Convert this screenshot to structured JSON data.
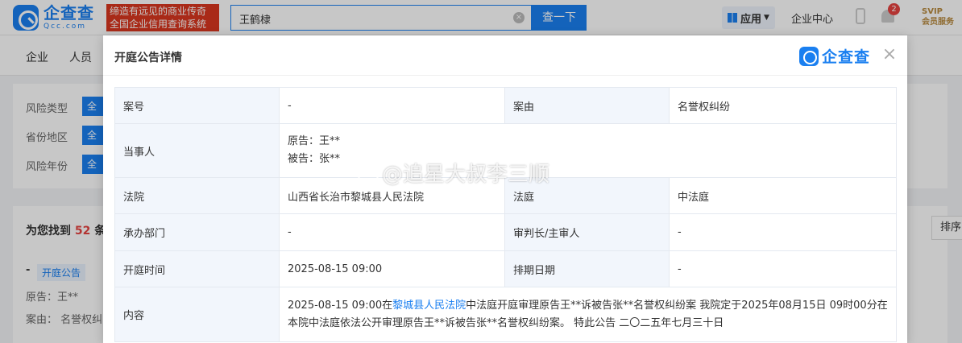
{
  "header": {
    "logo_cn": "企查查",
    "logo_en": "Qcc.com",
    "slogan_line1": "缔造有远见的商业传奇",
    "slogan_line2": "全国企业信用查询系统",
    "search_value": "王鹤棣",
    "search_button": "查一下",
    "apps_label": "应用",
    "enterprise_center": "企业中心",
    "notification_count": "2",
    "svip_line1": "SVIP",
    "svip_line2": "会员服务"
  },
  "nav": {
    "items": [
      "企业",
      "人员"
    ]
  },
  "filters": {
    "rows": [
      {
        "label": "风险类型",
        "chip": "全"
      },
      {
        "label": "省份地区",
        "chip": "全"
      },
      {
        "label": "风险年份",
        "chip": "全"
      }
    ]
  },
  "results": {
    "found_prefix": "为您找到",
    "count": "52",
    "found_suffix": "条",
    "sort_label": "排序",
    "item_dash": "-",
    "item_tag": "开庭公告",
    "item_plaintiff": "原告：王**",
    "item_cause": "案由：  名誉权纠"
  },
  "modal": {
    "title": "开庭公告详情",
    "logo_text": "企查查",
    "rows": {
      "case_no_label": "案号",
      "case_no_value": "-",
      "cause_label": "案由",
      "cause_value": "名誉权纠纷",
      "parties_label": "当事人",
      "plaintiff": "原告：王**",
      "defendant": "被告：张**",
      "court_label": "法院",
      "court_value": "山西省长治市黎城县人民法院",
      "courtroom_label": "法庭",
      "courtroom_value": "中法庭",
      "dept_label": "承办部门",
      "dept_value": "-",
      "judge_label": "审判长/主审人",
      "judge_value": "-",
      "hearing_time_label": "开庭时间",
      "hearing_time_value": "2025-08-15 09:00",
      "schedule_date_label": "排期日期",
      "schedule_date_value": "-",
      "content_label": "内容",
      "content_pre": "2025-08-15 09:00在",
      "content_court": "黎城县人民法院",
      "content_post": "中法庭开庭审理原告王**诉被告张**名誉权纠纷案 我院定于2025年08月15日 09时00分在本院中法庭依法公开审理原告王**诉被告张**名誉权纠纷案。 特此公告 二〇二五年七月三十日"
    }
  },
  "watermark": "@追星大叔李三顺",
  "colors": {
    "brand_blue": "#1a7ff0",
    "slogan_red": "#d9371f",
    "label_bg": "#f2f6fc"
  }
}
